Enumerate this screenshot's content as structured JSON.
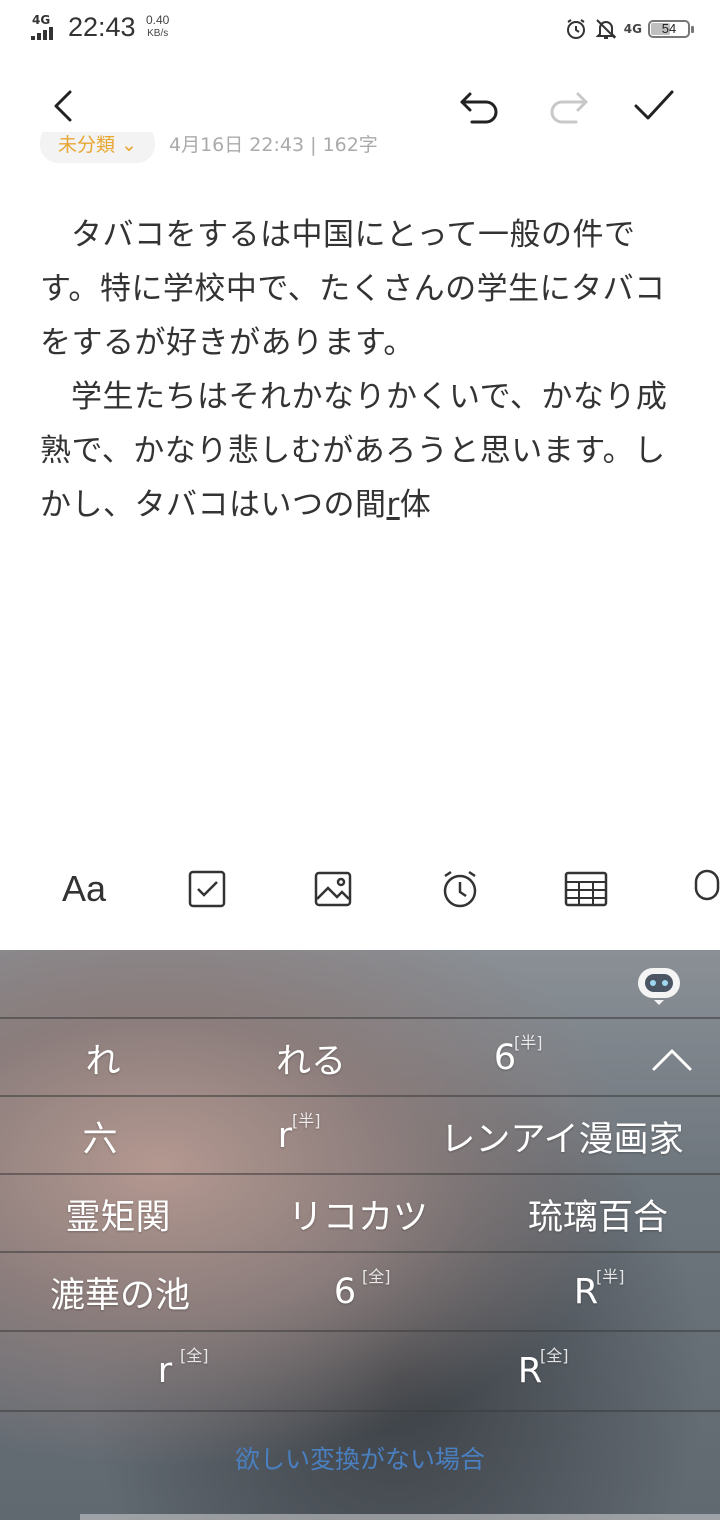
{
  "status_bar": {
    "network_label": "4G",
    "time": "22:43",
    "speed_value": "0.40",
    "speed_unit": "KB/s",
    "net_type": "4G",
    "battery": "54",
    "battery_level": 54
  },
  "toolbar": {
    "back_icon": "chevron-left-icon",
    "undo_icon": "undo-icon",
    "redo_icon": "redo-icon",
    "done_icon": "check-icon"
  },
  "note": {
    "folder": "未分類",
    "meta": "4月16日 22:43 | 162字",
    "paragraph1": "タバコをするは中国にとって一般の件です。特に学校中で、たくさんの学生にタバコをするが好きがあります。",
    "paragraph2_before": "学生たちはそれかなりかくいで、かなり成熟で、かなり悲しむがあろうと思います。しかし、タバコはいつの間",
    "composing": "r",
    "paragraph2_after": "体"
  },
  "format_bar": {
    "items": [
      "text-format-icon",
      "checklist-icon",
      "image-icon",
      "alarm-icon",
      "table-icon",
      "microphone-icon"
    ],
    "text_format_label": "Aa"
  },
  "keyboard": {
    "assistant_icon": "robot-icon",
    "rows": [
      {
        "c1": "れ",
        "c2": "れる",
        "c3": "6",
        "c3_tag": "[半]"
      },
      {
        "c1": "六",
        "c2": "r",
        "c2_tag": "[半]",
        "c3": "レンアイ漫画家"
      },
      {
        "c1": "霊矩関",
        "c2": "リコカツ",
        "c3": "琉璃百合"
      },
      {
        "c1": "漉華の池",
        "c2": "6",
        "c2_tag": "[全]",
        "c3": "R",
        "c3_tag": "[半]"
      },
      {
        "c1": "r",
        "c1_tag": "[全]",
        "c2": "R",
        "c2_tag": "[全]"
      }
    ],
    "no_match": "欲しい変換がない場合"
  }
}
